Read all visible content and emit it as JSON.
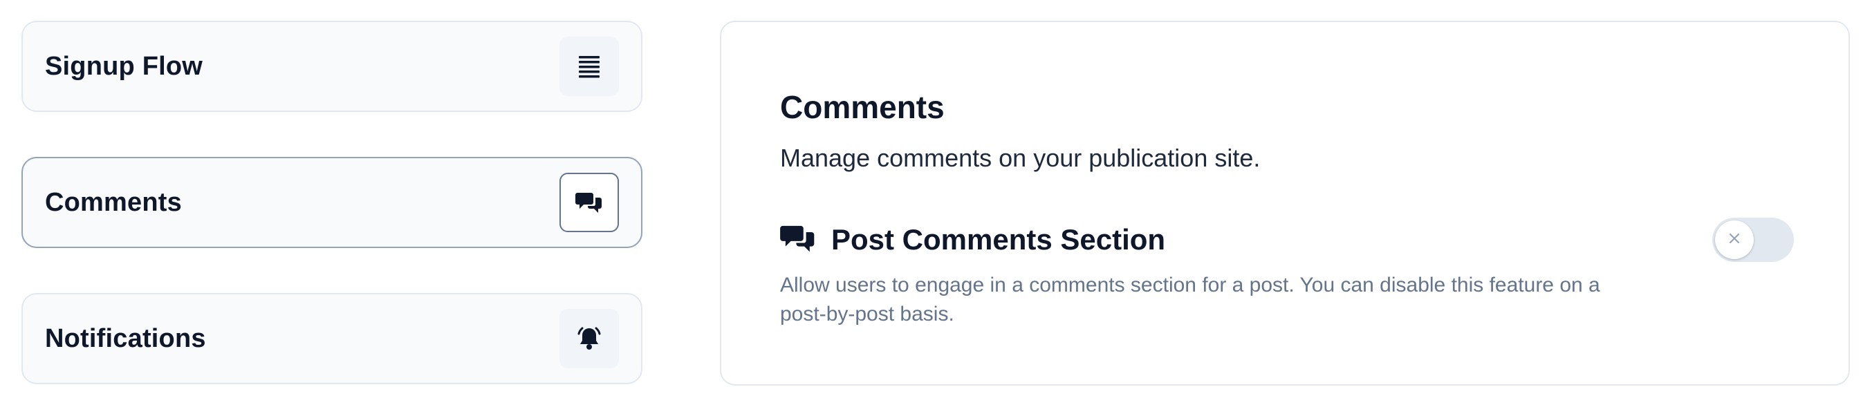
{
  "sidebar": {
    "items": [
      {
        "label": "Signup Flow",
        "icon": "list-lines-icon",
        "active": false
      },
      {
        "label": "Comments",
        "icon": "chat-bubbles-icon",
        "active": true
      },
      {
        "label": "Notifications",
        "icon": "bell-ringing-icon",
        "active": false
      }
    ]
  },
  "panel": {
    "title": "Comments",
    "description": "Manage comments on your publication site.",
    "setting": {
      "icon": "chat-bubbles-icon",
      "title": "Post Comments Section",
      "description": "Allow users to engage in a comments section for a post. You can disable this feature on a post-by-post basis.",
      "enabled": false
    }
  },
  "colors": {
    "text_primary": "#0f172a",
    "text_muted": "#64748b",
    "card_bg": "#f8fafc",
    "border": "#e2e8f0",
    "active_border": "#94a3b8",
    "toggle_off": "#e2e8f0"
  }
}
